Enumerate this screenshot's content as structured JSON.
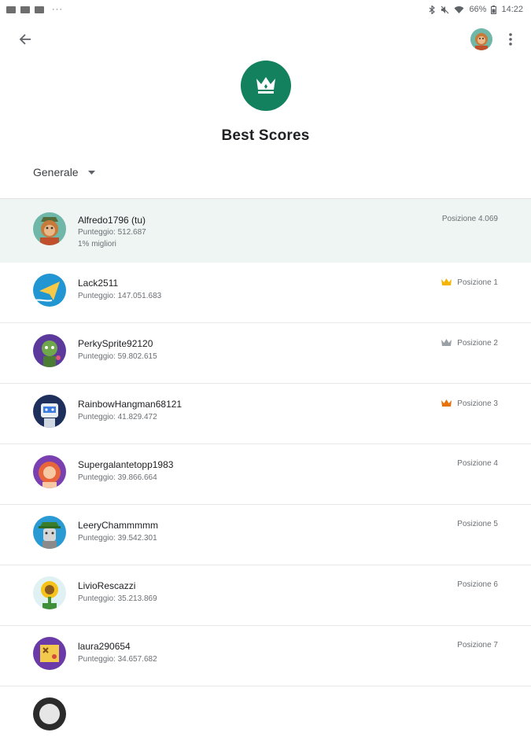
{
  "status_bar": {
    "dots": "···",
    "battery": "66%",
    "time": "14:22"
  },
  "header": {
    "title": "Best Scores",
    "filter_label": "Generale"
  },
  "colors": {
    "accent": "#13805e",
    "gold": "#f5b400",
    "silver": "#9aa0a6",
    "bronze": "#e8710a",
    "highlight_bg": "#eef5f3"
  },
  "current_player": {
    "name": "Alfredo1796 (tu)",
    "score": "Punteggio: 512.687",
    "percentile": "1% migliori",
    "position": "Posizione 4.069"
  },
  "entries": [
    {
      "name": "Lack2511",
      "score": "Punteggio: 147.051.683",
      "position": "Posizione 1",
      "medal": "gold"
    },
    {
      "name": "PerkySprite92120",
      "score": "Punteggio: 59.802.615",
      "position": "Posizione 2",
      "medal": "silver"
    },
    {
      "name": "RainbowHangman68121",
      "score": "Punteggio: 41.829.472",
      "position": "Posizione 3",
      "medal": "bronze"
    },
    {
      "name": "Supergalantetopp1983",
      "score": "Punteggio: 39.866.664",
      "position": "Posizione 4",
      "medal": ""
    },
    {
      "name": "LeeryChammmmm",
      "score": "Punteggio: 39.542.301",
      "position": "Posizione 5",
      "medal": ""
    },
    {
      "name": "LivioRescazzi",
      "score": "Punteggio: 35.213.869",
      "position": "Posizione 6",
      "medal": ""
    },
    {
      "name": "laura290654",
      "score": "Punteggio: 34.657.682",
      "position": "Posizione 7",
      "medal": ""
    }
  ]
}
